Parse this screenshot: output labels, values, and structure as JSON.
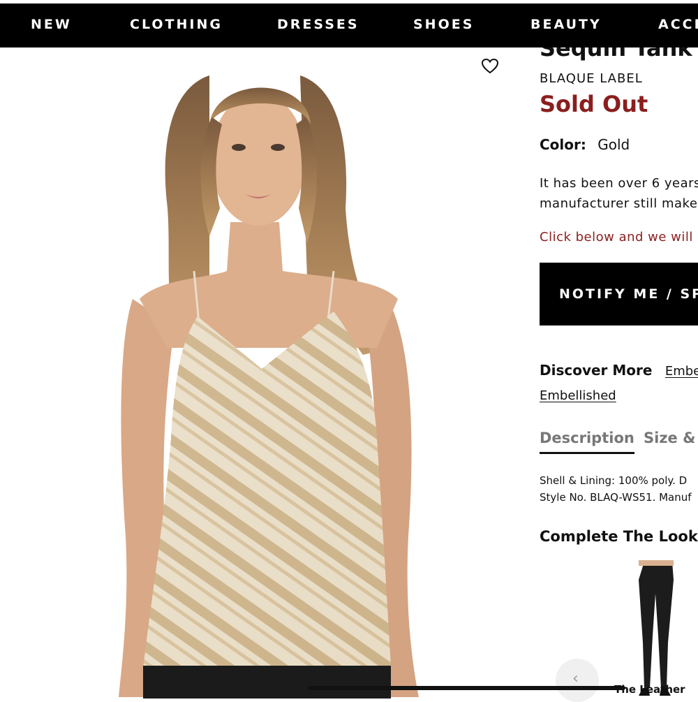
{
  "nav": {
    "items": [
      "NEW",
      "CLOTHING",
      "DRESSES",
      "SHOES",
      "BEAUTY",
      "ACCE"
    ]
  },
  "product": {
    "title": "Sequin Tank",
    "brand": "BLAQUE LABEL",
    "status": "Sold Out",
    "color_label": "Color:",
    "color_value": "Gold",
    "description_lines": [
      "It has been over 6 years",
      "manufacturer still make"
    ],
    "notice": "Click below and we will l",
    "notify_button": "NOTIFY ME / SPE",
    "discover_label": "Discover More",
    "discover_links": [
      "Embel",
      "Embellished"
    ],
    "tabs": [
      "Description",
      "Size &"
    ],
    "specs": [
      "Shell & Lining: 100% poly. D",
      "Style No. BLAQ-WS51. Manuf"
    ],
    "complete_the_look": "Complete The Look",
    "look_item_label": "The Leather"
  },
  "icons": {
    "wishlist": "heart-icon",
    "carousel_prev": "chevron-left-icon"
  },
  "colors": {
    "nav_bg": "#000000",
    "sold_out": "#8b1e1e",
    "notify_bg": "#000000"
  }
}
